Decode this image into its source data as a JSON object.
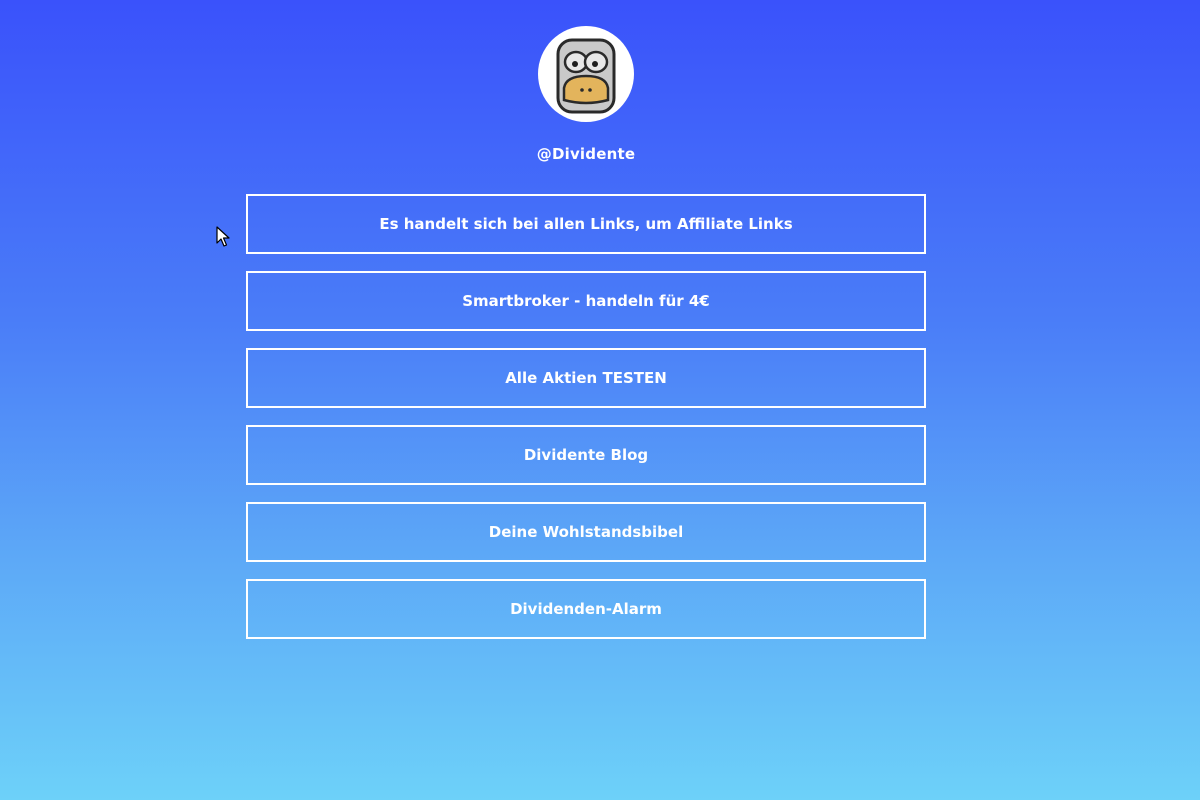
{
  "profile": {
    "handle": "@Dividente",
    "avatar_icon": "monkey-face-icon"
  },
  "links": [
    {
      "label": "Es handelt sich bei allen Links, um Affiliate Links"
    },
    {
      "label": "Smartbroker - handeln für 4€"
    },
    {
      "label": "Alle Aktien TESTEN"
    },
    {
      "label": "Dividente Blog"
    },
    {
      "label": "Deine Wohlstandsbibel"
    },
    {
      "label": "Dividenden-Alarm"
    }
  ],
  "colors": {
    "background_top": "#3a52fb",
    "background_bottom": "#6dd1f9",
    "button_border": "#ffffff",
    "text": "#ffffff"
  }
}
